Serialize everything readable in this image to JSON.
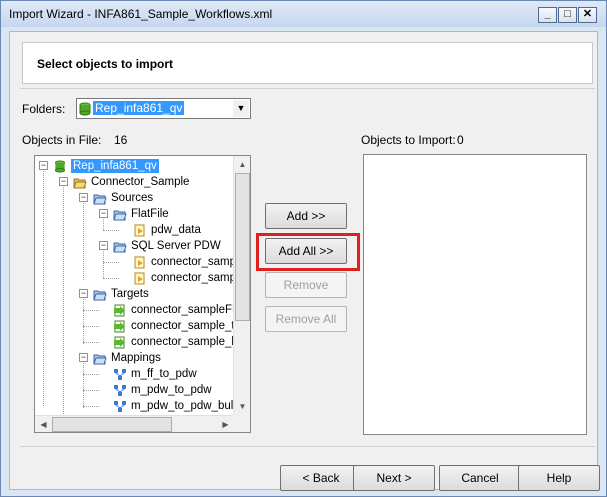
{
  "window": {
    "title": "Import Wizard - INFA861_Sample_Workflows.xml"
  },
  "header": {
    "text": "Select objects to import"
  },
  "folders": {
    "label": "Folders:",
    "selected": "Rep_infa861_qv"
  },
  "objects_in_file": {
    "label": "Objects in File:",
    "count": "16"
  },
  "objects_to_import": {
    "label": "Objects to Import:",
    "count": "0"
  },
  "tree": {
    "root": "Rep_infa861_qv",
    "connector": "Connector_Sample",
    "sources": "Sources",
    "flatfile": "FlatFile",
    "pdw_data": "pdw_data",
    "sqlserver": "SQL Server PDW",
    "src1": "connector_samp",
    "src2": "connector_samp",
    "targets": "Targets",
    "tgt1": "connector_sampleFF",
    "tgt2": "connector_sample_ta",
    "tgt3": "connector_sample_b",
    "mappings": "Mappings",
    "map1": "m_ff_to_pdw",
    "map2": "m_pdw_to_pdw",
    "map3": "m_pdw_to_pdw_bull"
  },
  "buttons": {
    "add": "Add >>",
    "add_all": "Add All >>",
    "remove": "Remove",
    "remove_all": "Remove All",
    "back": "< Back",
    "next": "Next >",
    "cancel": "Cancel",
    "help": "Help"
  },
  "colors": {
    "highlight": "#e02020",
    "selection": "#3399ff"
  }
}
